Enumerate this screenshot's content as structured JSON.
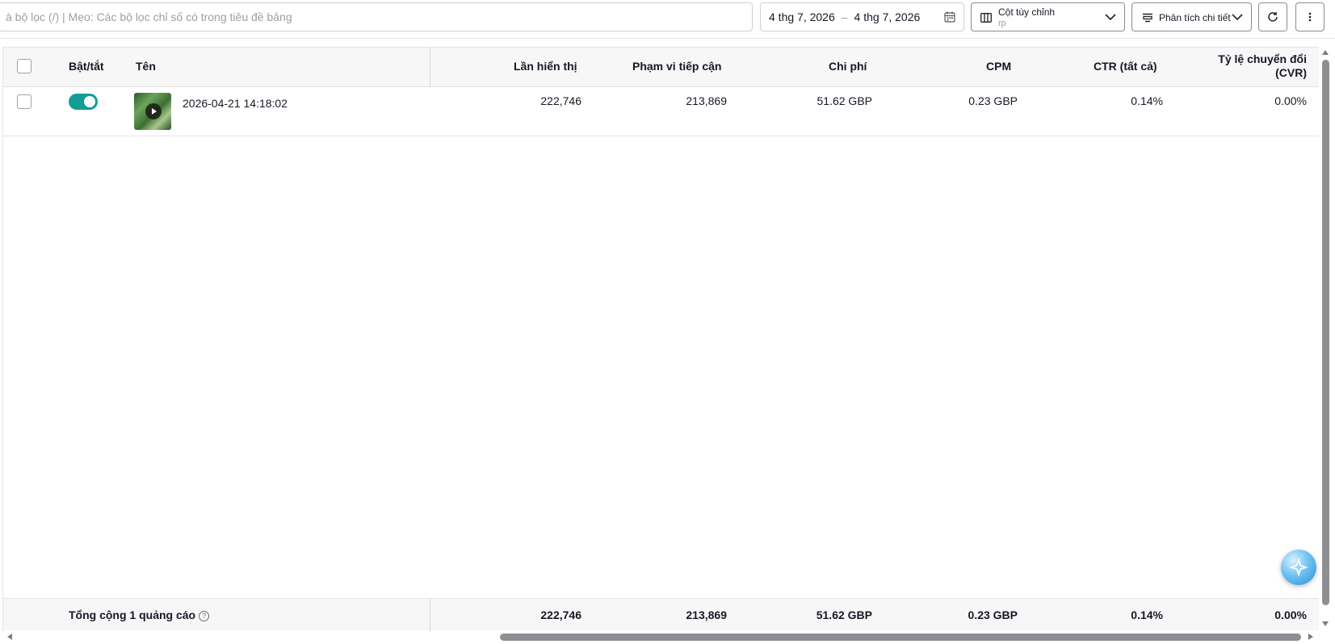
{
  "toolbar": {
    "search_placeholder": "à bộ lọc (/) | Mẹo: Các bộ lọc chỉ số có trong tiêu đề bảng",
    "date_start": "4 thg 7, 2026",
    "date_separator": "–",
    "date_end": "4 thg 7, 2026",
    "columns_label": "Cột tùy chỉnh",
    "columns_sub": "rp",
    "analysis_label": "Phân tích chi tiết"
  },
  "table": {
    "headers": {
      "toggle": "Bật/tắt",
      "name": "Tên",
      "impressions": "Lần hiển thị",
      "reach": "Phạm vi tiếp cận",
      "cost": "Chi phí",
      "cpm": "CPM",
      "ctr": "CTR (tất cả)",
      "cvr_line1": "Tỷ lệ chuyển đổi",
      "cvr_line2": "(CVR)"
    },
    "rows": [
      {
        "name": "2026-04-21 14:18:02",
        "enabled": true,
        "impressions": "222,746",
        "reach": "213,869",
        "cost": "51.62 GBP",
        "cpm": "0.23 GBP",
        "ctr": "0.14%",
        "cvr": "0.00%"
      }
    ],
    "footer": {
      "label": "Tổng cộng 1 quảng cáo",
      "help_icon": "?",
      "impressions": "222,746",
      "reach": "213,869",
      "cost": "51.62 GBP",
      "cpm": "0.23 GBP",
      "ctr": "0.14%",
      "cvr": "0.00%"
    }
  },
  "colors": {
    "toggle_on": "#129e96",
    "header_bg": "#f7f7f8"
  },
  "icons": {
    "calendar": "calendar-icon",
    "columns": "columns-icon",
    "analysis": "breakdown-icon",
    "refresh": "refresh-icon",
    "more": "more-vertical-icon",
    "assistant": "ai-assistant-icon",
    "play": "play-icon"
  }
}
